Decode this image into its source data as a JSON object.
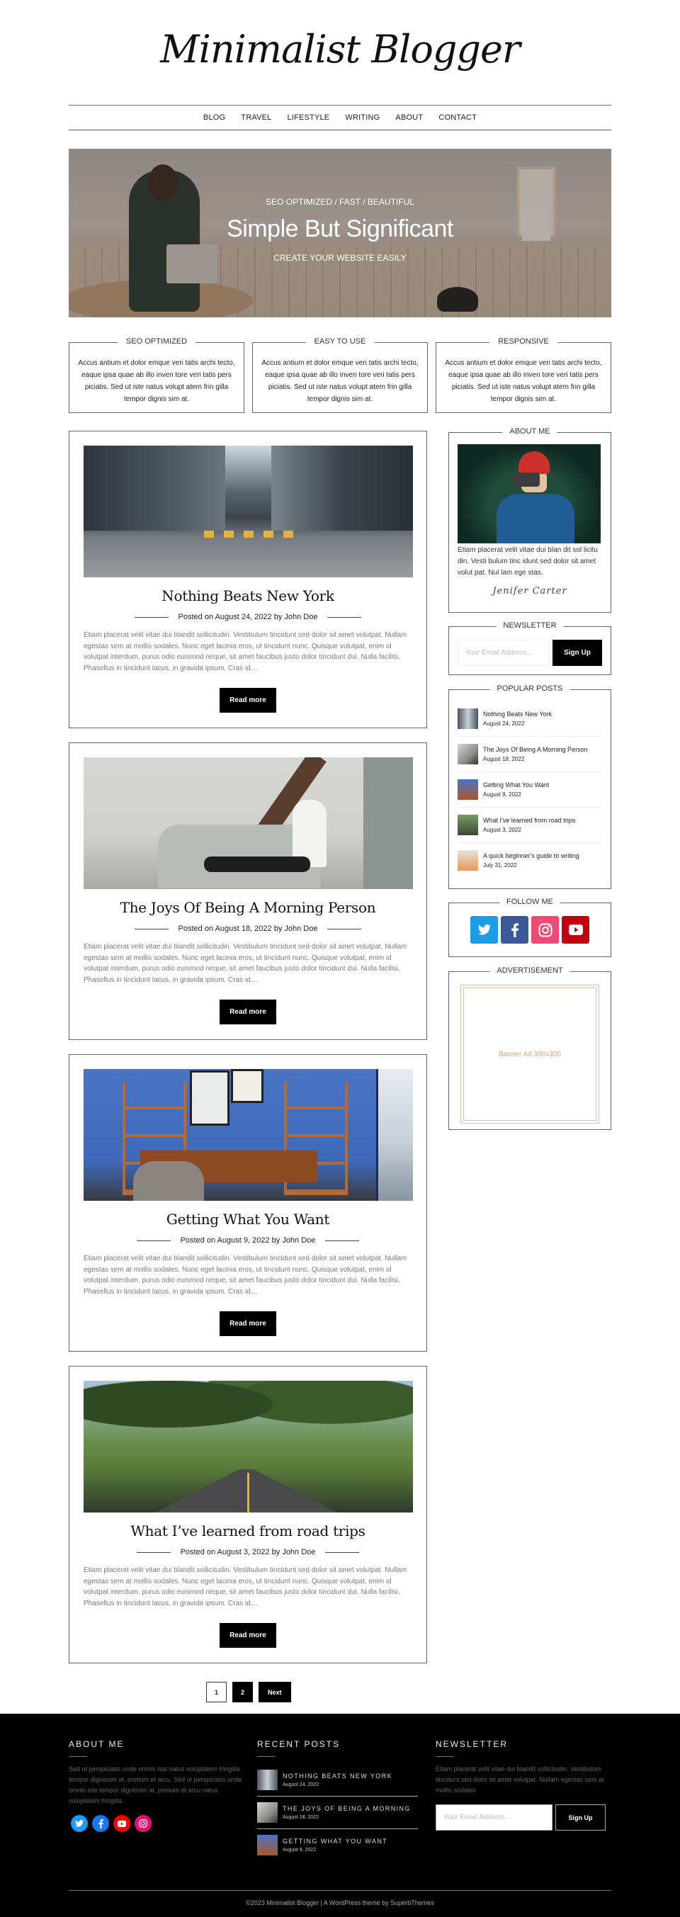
{
  "site": {
    "title": "Minimalist Blogger"
  },
  "nav": {
    "items": [
      "BLOG",
      "TRAVEL",
      "LIFESTYLE",
      "WRITING",
      "ABOUT",
      "CONTACT"
    ]
  },
  "hero": {
    "kicker": "SEO OPTIMIZED / FAST / BEAUTIFUL",
    "title": "Simple But Significant",
    "subtitle": "CREATE YOUR WEBSITE EASILY"
  },
  "features": [
    {
      "title": "SEO OPTIMIZED",
      "text": "Accus antium et dolor emque veri tatis archi tecto, eaque ipsa quae ab illo inven tore veri tatis pers piciatis. Sed ut iste natus volupt atem frin gilla tempor dignis sim at."
    },
    {
      "title": "EASY TO USE",
      "text": "Accus antium et dolor emque veri tatis archi tecto, eaque ipsa quae ab illo inven tore veri tatis pers piciatis. Sed ut iste natus volupt atem frin gilla tempor dignis sim at."
    },
    {
      "title": "RESPONSIVE",
      "text": "Accus antium et dolor emque veri tatis archi tecto, eaque ipsa quae ab illo inven tore veri tatis pers piciatis. Sed ut iste natus volupt atem frin gilla tempor dignis sim at."
    }
  ],
  "posts": [
    {
      "title": "Nothing Beats New York",
      "meta": "Posted on August 24, 2022 by John Doe",
      "excerpt": "Etiam placerat velit vitae dui blandit sollicitudin. Vestibulum tincidunt sed dolor sit amet volutpat. Nullam egestas sem at mollis sodales. Nunc eget lacinia eros, ut tincidunt nunc. Quisque volutpat, enim id volutpat interdum, purus odio euismod neque, sit amet faucibus justo dolor tincidunt dui. Nulla facilisi. Phasellus in tincidunt lacus, in gravida ipsum. Cras id…",
      "button": "Read more"
    },
    {
      "title": "The Joys Of Being A Morning Person",
      "meta": "Posted on August 18, 2022 by John Doe",
      "excerpt": "Etiam placerat velit vitae dui blandit sollicitudin. Vestibulum tincidunt sed dolor sit amet volutpat. Nullam egestas sem at mollis sodales. Nunc eget lacinia eros, ut tincidunt nunc. Quisque volutpat, enim id volutpat interdum, purus odio euismod neque, sit amet faucibus justo dolor tincidunt dui. Nulla facilisi. Phasellus in tincidunt lacus, in gravida ipsum. Cras id…",
      "button": "Read more"
    },
    {
      "title": "Getting What You Want",
      "meta": "Posted on August 9, 2022 by John Doe",
      "excerpt": "Etiam placerat velit vitae dui blandit sollicitudin. Vestibulum tincidunt sed dolor sit amet volutpat. Nullam egestas sem at mollis sodales. Nunc eget lacinia eros, ut tincidunt nunc. Quisque volutpat, enim id volutpat interdum, purus odio euismod neque, sit amet faucibus justo dolor tincidunt dui. Nulla facilisi. Phasellus in tincidunt lacus, in gravida ipsum. Cras id…",
      "button": "Read more"
    },
    {
      "title": "What I’ve learned from road trips",
      "meta": "Posted on August 3, 2022 by John Doe",
      "excerpt": "Etiam placerat velit vitae dui blandit sollicitudin. Vestibulum tincidunt sed dolor sit amet volutpat. Nullam egestas sem at mollis sodales. Nunc eget lacinia eros, ut tincidunt nunc. Quisque volutpat, enim id volutpat interdum, purus odio euismod neque, sit amet faucibus justo dolor tincidunt dui. Nulla facilisi. Phasellus in tincidunt lacus, in gravida ipsum. Cras id…",
      "button": "Read more"
    }
  ],
  "sidebar": {
    "about": {
      "title": "ABOUT ME",
      "text": "Etiam placerat velit vitae dui blan dit sol licitu din. Vesti bulum tinc idunt sed dolor sit amet volut pat. Nul lam ege stas.",
      "signature": "Jenifer Carter"
    },
    "newsletter": {
      "title": "NEWSLETTER",
      "placeholder": "Your Email Address...",
      "button": "Sign Up"
    },
    "popular": {
      "title": "POPULAR POSTS",
      "items": [
        {
          "title": "Nothing Beats New York",
          "date": "August 24, 2022"
        },
        {
          "title": "The Joys Of Being A Morning Person",
          "date": "August 18, 2022"
        },
        {
          "title": "Getting What You Want",
          "date": "August 9, 2022"
        },
        {
          "title": "What I've learned from road trips",
          "date": "August 3, 2022"
        },
        {
          "title": "A quick beginner's guide to writing",
          "date": "July 31, 2022"
        }
      ]
    },
    "follow": {
      "title": "FOLLOW ME",
      "networks": [
        {
          "name": "twitter",
          "color": "#1b9ee6"
        },
        {
          "name": "facebook",
          "color": "#3b5998"
        },
        {
          "name": "instagram",
          "color": "#ef4a76"
        },
        {
          "name": "youtube",
          "color": "#c4000c"
        }
      ]
    },
    "ad": {
      "title": "ADVERTISEMENT",
      "label": "Banner Ad 300x300"
    }
  },
  "pagination": {
    "pages": [
      "1",
      "2"
    ],
    "current": "1",
    "next": "Next"
  },
  "footer": {
    "about": {
      "title": "ABOUT ME",
      "text": "Sed ut perspiciatis unde omnis iste natus voluptatem fringilla tempor dignissim at, pretium et arcu. Sed ut perspiciatis unde omnis iste tempor dignissim at, pretium et arcu natus voluptatem fringilla.",
      "social": [
        {
          "name": "twitter",
          "color": "#1d9bf0"
        },
        {
          "name": "facebook",
          "color": "#1877f2"
        },
        {
          "name": "youtube",
          "color": "#ff0000"
        },
        {
          "name": "instagram",
          "color": "#e4107a"
        }
      ]
    },
    "recent": {
      "title": "RECENT POSTS",
      "items": [
        {
          "title": "NOTHING BEATS NEW YORK",
          "date": "August 24, 2022"
        },
        {
          "title": "THE JOYS OF BEING A MORNING",
          "date": "August 18, 2022"
        },
        {
          "title": "GETTING WHAT YOU WANT",
          "date": "August 9, 2022"
        }
      ]
    },
    "newsletter": {
      "title": "NEWSLETTER",
      "text": "Etiam placerat velit vitae dui blandit sollicitudin. Vestibulum tincidunt sed dolor sit amet volutpat. Nullam egestas sem at mollis sodales",
      "placeholder": "Your Email Address...",
      "button": "Sign Up"
    },
    "copyright": "©2023 Minimalist Blogger | A WordPress theme by SuperbThemes"
  }
}
